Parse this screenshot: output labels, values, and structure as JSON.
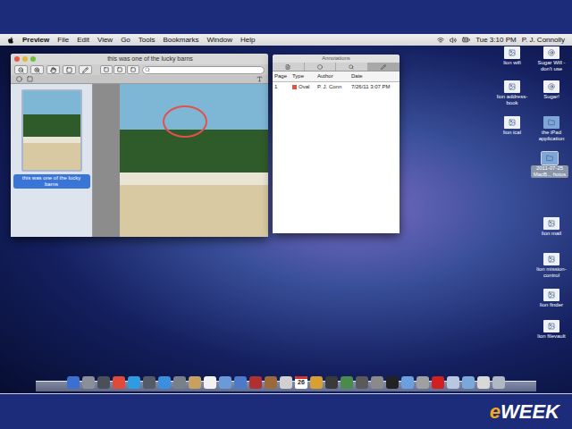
{
  "menubar": {
    "app": "Preview",
    "menus": [
      "File",
      "Edit",
      "View",
      "Go",
      "Tools",
      "Bookmarks",
      "Window",
      "Help"
    ],
    "clock": "Tue 3:10 PM",
    "user": "P. J. Connolly"
  },
  "preview": {
    "title": "this was one of the lucky barns",
    "thumbnail_label": "this was one of the lucky barns",
    "thumbnail_selected": true
  },
  "annotations": {
    "title": "Annotations",
    "tool_tabs": [
      {
        "selected": false
      },
      {
        "selected": false
      },
      {
        "selected": false
      },
      {
        "selected": true
      }
    ],
    "columns": [
      "Page",
      "Type",
      "Author",
      "Date"
    ],
    "rows": [
      {
        "page": "1",
        "type": "Oval",
        "author": "P. J. Conn",
        "date": "7/26/11 3:07 PM",
        "color": "#e0524a",
        "selected": false
      }
    ]
  },
  "desktop_icons": [
    {
      "label": "lion wifi",
      "kind": "screenshot",
      "selected": false
    },
    {
      "label": "Sugar Will - don't use",
      "kind": "link",
      "selected": false
    },
    {
      "label": "lion address-book",
      "kind": "screenshot",
      "selected": false
    },
    {
      "label": "Sugar!",
      "kind": "link",
      "selected": false
    },
    {
      "label": "lion ical",
      "kind": "screenshot",
      "selected": false
    },
    {
      "label": "the iPad application",
      "kind": "folder",
      "selected": false
    },
    {
      "label": "2011-07-25 MacB... hotos",
      "kind": "folder",
      "selected": true
    },
    {
      "label": "lion mail",
      "kind": "screenshot",
      "selected": false
    },
    {
      "label": "lion mission-control",
      "kind": "screenshot",
      "selected": false
    },
    {
      "label": "lion finder",
      "kind": "screenshot",
      "selected": false
    },
    {
      "label": "lion filevault",
      "kind": "screenshot",
      "selected": false
    }
  ],
  "dock": {
    "calendar_day": "26"
  },
  "logo": {
    "prefix": "e",
    "name": "WEEK"
  }
}
